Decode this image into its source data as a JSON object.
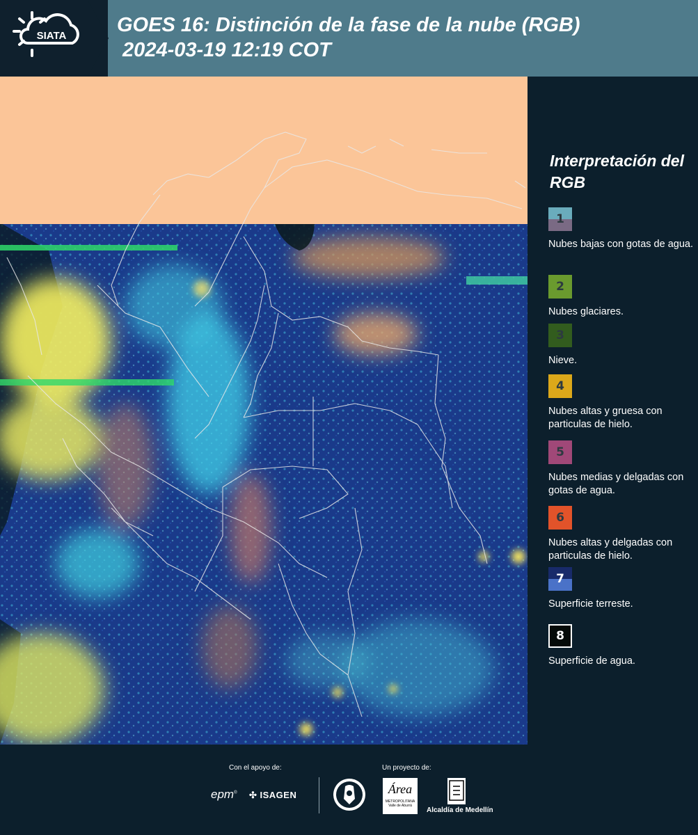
{
  "header": {
    "logo_text": "SIATA",
    "title_line1": "GOES 16: Distinción de la fase de la nube (RGB)",
    "title_line2": " 2024-03-19 12:19 COT"
  },
  "legend": {
    "title": "Interpretación del RGB",
    "items": [
      {
        "number": "1",
        "label": "Nubes bajas con gotas de agua.",
        "color_top": "#6aacbc",
        "color_bottom": "#7a6a84"
      },
      {
        "number": "2",
        "label": "Nubes glaciares.",
        "color_top": "#6a9a2e",
        "color_bottom": "#6a9a2e"
      },
      {
        "number": "3",
        "label": "Nieve.",
        "color_top": "#325c1e",
        "color_bottom": "#325c1e"
      },
      {
        "number": "4",
        "label": "Nubes altas y gruesa con particulas de hielo.",
        "color_top": "#dca81a",
        "color_bottom": "#dca81a"
      },
      {
        "number": "5",
        "label": "Nubes medias y delgadas con gotas de agua.",
        "color_top": "#a04878",
        "color_bottom": "#a04878"
      },
      {
        "number": "6",
        "label": "Nubes altas y delgadas con particulas de hielo.",
        "color_top": "#e2532a",
        "color_bottom": "#e2532a"
      },
      {
        "number": "7",
        "label": "Superficie terreste.",
        "color_top": "#182a6a",
        "color_bottom": "#4a72c8"
      },
      {
        "number": "8",
        "label": "Superficie de agua.",
        "color_top": "#050a08",
        "color_bottom": "#050a08"
      }
    ]
  },
  "footer": {
    "support_label": "Con el apoyo de:",
    "project_label": "Un proyecto de:",
    "logo_epm": "epm",
    "logo_isagen": "ISAGEN",
    "logo_area": "Área",
    "logo_area_sub1": "METROPOLITANA",
    "logo_area_sub2": "Valle de Aburrá",
    "logo_alcaldia": "Alcaldía de Medellín"
  },
  "colors": {
    "header_bar": "#4f7b8b",
    "background": "#0c1f2c",
    "no_data": "#fbc598",
    "land_surface": "#1a3a8a",
    "border_lines": "#e8e8e8"
  }
}
